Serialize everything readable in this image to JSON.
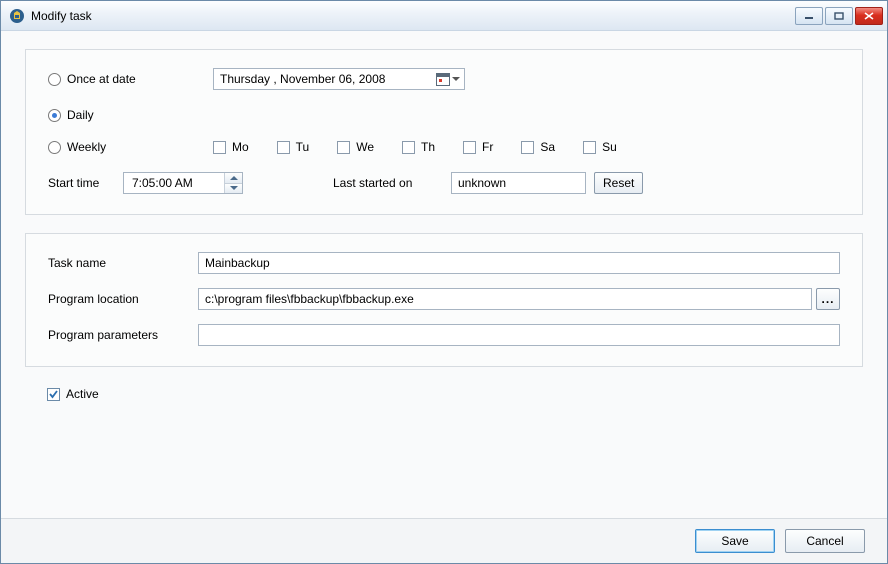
{
  "window": {
    "title": "Modify task"
  },
  "schedule": {
    "options": {
      "once": {
        "label": "Once at date",
        "selected": false
      },
      "daily": {
        "label": "Daily",
        "selected": true
      },
      "weekly": {
        "label": "Weekly",
        "selected": false
      }
    },
    "date_value": "Thursday , November 06, 2008",
    "days": {
      "mo": {
        "label": "Mo",
        "checked": false
      },
      "tu": {
        "label": "Tu",
        "checked": false
      },
      "we": {
        "label": "We",
        "checked": false
      },
      "th": {
        "label": "Th",
        "checked": false
      },
      "fr": {
        "label": "Fr",
        "checked": false
      },
      "sa": {
        "label": "Sa",
        "checked": false
      },
      "su": {
        "label": "Su",
        "checked": false
      }
    },
    "start_time_label": "Start time",
    "start_time_value": "7:05:00 AM",
    "last_started_label": "Last started on",
    "last_started_value": "unknown",
    "reset_label": "Reset"
  },
  "task": {
    "name_label": "Task name",
    "name_value": "Mainbackup",
    "location_label": "Program location",
    "location_value": "c:\\program files\\fbbackup\\fbbackup.exe",
    "params_label": "Program parameters",
    "params_value": "",
    "browse_label": "..."
  },
  "active": {
    "label": "Active",
    "checked": true
  },
  "footer": {
    "save_label": "Save",
    "cancel_label": "Cancel"
  }
}
